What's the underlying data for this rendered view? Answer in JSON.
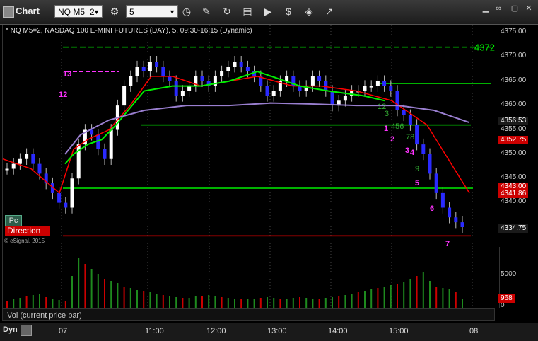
{
  "window": {
    "app_title": "Chart",
    "symbol": "NQ M5=2",
    "interval": "5"
  },
  "chart": {
    "header": "* NQ M5=2, NASDAQ 100 E-MINI FUTURES (DAY), 5, 09:30-16:15 (Dynamic)",
    "copyright": "© eSignal, 2015",
    "pc_label": "Pc",
    "direction_label": "Direction",
    "level_label": "4372",
    "price_ticks": [
      "4375.00",
      "4370.00",
      "4365.00",
      "4360.00",
      "4355.00",
      "4350.00",
      "4345.00",
      "4340.00"
    ],
    "price_tags": [
      {
        "text": "4356.53",
        "bg": "#1a1a1a",
        "fg": "#ffffff"
      },
      {
        "text": "4352.75",
        "bg": "#cc0000",
        "fg": "#ffffff"
      },
      {
        "text": "4343.00",
        "bg": "#cc0000",
        "fg": "#ffffff"
      },
      {
        "text": "4341.86",
        "bg": "#cc0000",
        "fg": "#ffffff"
      },
      {
        "text": "4334.75",
        "bg": "#1a1a1a",
        "fg": "#ffffff"
      }
    ],
    "markers": [
      {
        "text": "13",
        "color": "#ff33ff"
      },
      {
        "text": "12",
        "color": "#ff33ff"
      },
      {
        "text": "12",
        "color": "#33aa33"
      },
      {
        "text": "3",
        "color": "#33aa33"
      },
      {
        "text": "456",
        "color": "#33aa33"
      },
      {
        "text": "1",
        "color": "#ff33ff"
      },
      {
        "text": "2",
        "color": "#ff33ff"
      },
      {
        "text": "78",
        "color": "#33aa33"
      },
      {
        "text": "3",
        "color": "#ff33ff"
      },
      {
        "text": "4",
        "color": "#ff33ff"
      },
      {
        "text": "9",
        "color": "#33aa33"
      },
      {
        "text": "5",
        "color": "#ff33ff"
      },
      {
        "text": "6",
        "color": "#ff33ff"
      },
      {
        "text": "7",
        "color": "#ff33ff"
      }
    ]
  },
  "volume": {
    "label": "Vol (current price bar)",
    "ticks": [
      "5000",
      "0"
    ],
    "current_tag": "968"
  },
  "time_axis": {
    "dyn_label": "Dyn",
    "labels": [
      "07",
      "11:00",
      "12:00",
      "13:00",
      "14:00",
      "15:00",
      "08"
    ]
  },
  "colors": {
    "up_candle": "#ffffff",
    "down_candle": "#2a2aff",
    "green_line": "#00ee00",
    "red_line": "#ff0000",
    "purple_line": "#9a7fd0",
    "magenta_line": "#ff33ff"
  }
}
